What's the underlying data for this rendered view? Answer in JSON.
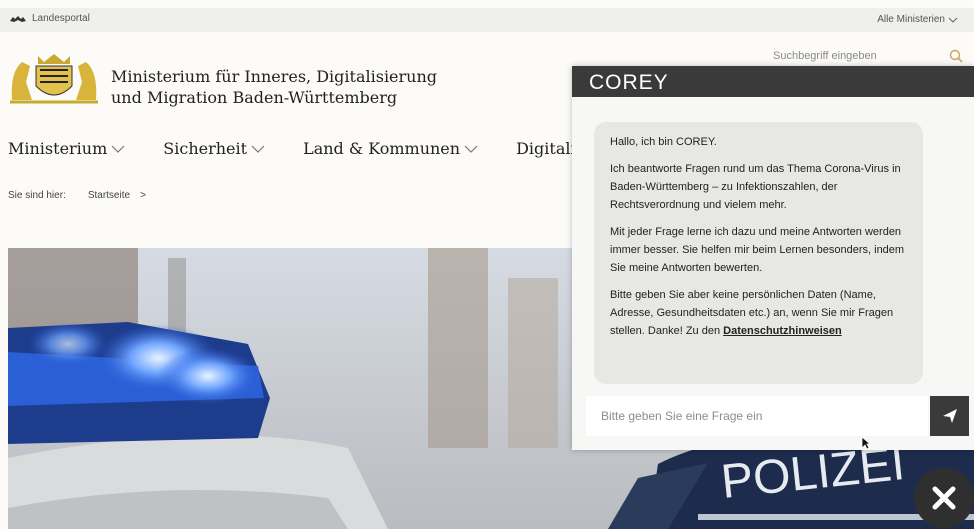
{
  "topbar": {
    "portal_label": "Landesportal",
    "ministries_label": "Alle Ministerien"
  },
  "header": {
    "title_line1": "Ministerium für Inneres, Digitalisierung",
    "title_line2": "und Migration Baden-Württemberg"
  },
  "search": {
    "placeholder": "Suchbegriff eingeben"
  },
  "nav": {
    "items": [
      {
        "label": "Ministerium"
      },
      {
        "label": "Sicherheit"
      },
      {
        "label": "Land & Kommunen"
      },
      {
        "label": "Digitalisierung"
      }
    ]
  },
  "breadcrumb": {
    "prefix": "Sie sind hier:",
    "home": "Startseite",
    "separator": ">"
  },
  "hero": {
    "vehicle_text": "POLIZEI"
  },
  "chat": {
    "title": "COREY",
    "messages": [
      "Hallo, ich bin COREY.",
      "Ich beantworte Fragen rund um das Thema Corona-Virus in Baden-Württemberg – zu Infektionszahlen, der Rechtsverordnung und vielem mehr.",
      "Mit jeder Frage lerne ich dazu und meine Antworten werden immer besser. Sie helfen mir beim Lernen besonders, indem Sie meine Antworten bewerten.",
      "Bitte geben Sie aber keine persönlichen Daten (Name, Adresse, Gesundheitsdaten etc.) an, wenn Sie mir Fragen stellen. Danke! Zu den"
    ],
    "privacy_link": "Datenschutzhinweisen",
    "input_placeholder": "Bitte geben Sie eine Frage ein"
  },
  "icons": {
    "search": "search-icon",
    "chevron": "chevron-down-icon",
    "send": "send-icon",
    "close": "close-icon",
    "crest": "coat-of-arms-icon",
    "cursor": "mouse-cursor-icon"
  },
  "colors": {
    "chat_header": "#3a3a3a",
    "bubble": "#e7e7e3",
    "page_bg": "#fcfbf8",
    "police_blue": "#2a5fd6"
  }
}
